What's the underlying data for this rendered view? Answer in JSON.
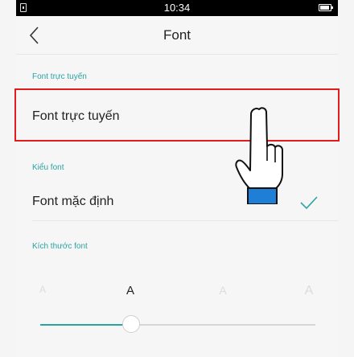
{
  "status_bar": {
    "time": "10:34"
  },
  "header": {
    "title": "Font"
  },
  "sections": {
    "online": {
      "label": "Font trực tuyến",
      "row": "Font trực tuyến"
    },
    "style": {
      "label": "Kiểu font",
      "row": "Font mặc định",
      "checked": true
    },
    "size": {
      "label": "Kích thước font",
      "letters": [
        "A",
        "A",
        "A",
        "A"
      ],
      "selected_index": 1,
      "value_fraction": 0.33
    }
  },
  "colors": {
    "accent": "#2aa3a3",
    "highlight": "#e21c1c",
    "cuff": "#1f7fd6"
  },
  "icons": [
    "back-arrow-icon",
    "sim-card-icon",
    "battery-icon",
    "checkmark-icon",
    "pointing-hand-icon"
  ]
}
